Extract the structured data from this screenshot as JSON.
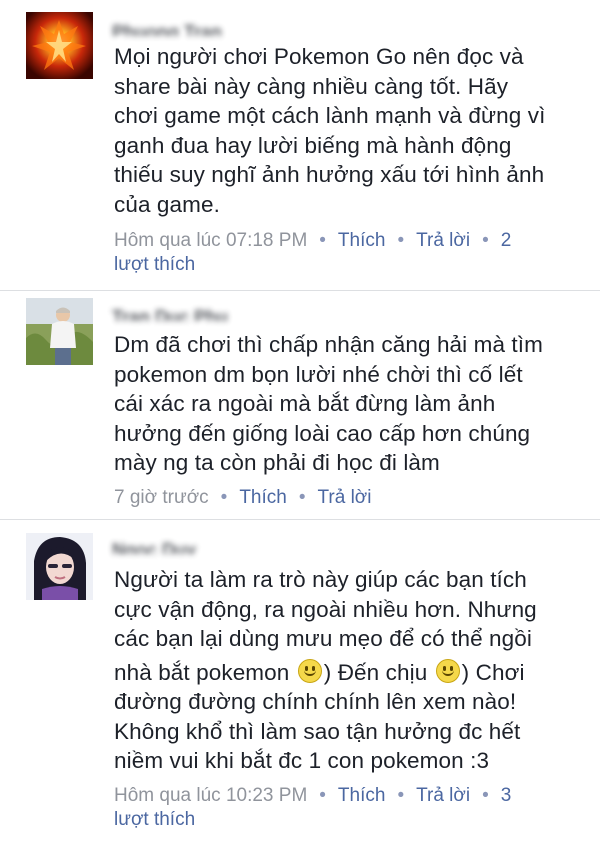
{
  "comments": [
    {
      "author": "Phuong Tran",
      "lines": [
        "Mọi người chơi Pokemon Go nên đọc và",
        "share bài này càng nhiều càng tốt. Hãy",
        "chơi game một cách lành mạnh và đừng vì",
        "ganh đua hay lười biếng mà hành động",
        "thiếu suy nghĩ ảnh hưởng xấu tới hình ảnh",
        "của game."
      ],
      "time": "Hôm qua lúc 07:18 PM",
      "like_label": "Thích",
      "reply_label": "Trả lời",
      "likes_count": "2",
      "likes_word": "lượt thích",
      "avatar_icon": "phoenix-fire-icon"
    },
    {
      "author": "Tran Duc Phu",
      "lines": [
        "Dm đã chơi thì chấp nhận căng hải mà tìm",
        "pokemon dm bọn lười nhé chời thì cố lết",
        "cái xác ra ngoài mà bắt đừng làm ảnh",
        "hưởng đến giống loài cao cấp hơn chúng",
        "mày ng ta còn phải đi học đi làm"
      ],
      "time": "7 giờ trước",
      "like_label": "Thích",
      "reply_label": "Trả lời",
      "avatar_icon": "person-photo-icon"
    },
    {
      "author": "Ngoc Duy",
      "lines_pre": [
        "Người ta làm ra trò này giúp các bạn tích",
        "cực vận động, ra ngoài nhiều hơn. Nhưng",
        "các bạn lại dùng mưu mẹo để có thể ngồi"
      ],
      "emoji_line_part1": "nhà bắt pokemon",
      "emoji_line_part2": "Đến chịu",
      "emoji_line_part3": "Chơi",
      "lines_post": [
        "đường đường chính chính lên xem nào!",
        "Không khổ thì làm sao tận hưởng đc hết",
        "niềm vui khi bắt đc 1 con pokemon :3"
      ],
      "time": "Hôm qua lúc 10:23 PM",
      "like_label": "Thích",
      "reply_label": "Trả lời",
      "likes_count": "3",
      "likes_word": "lượt thích",
      "avatar_icon": "girl-photo-icon"
    }
  ]
}
